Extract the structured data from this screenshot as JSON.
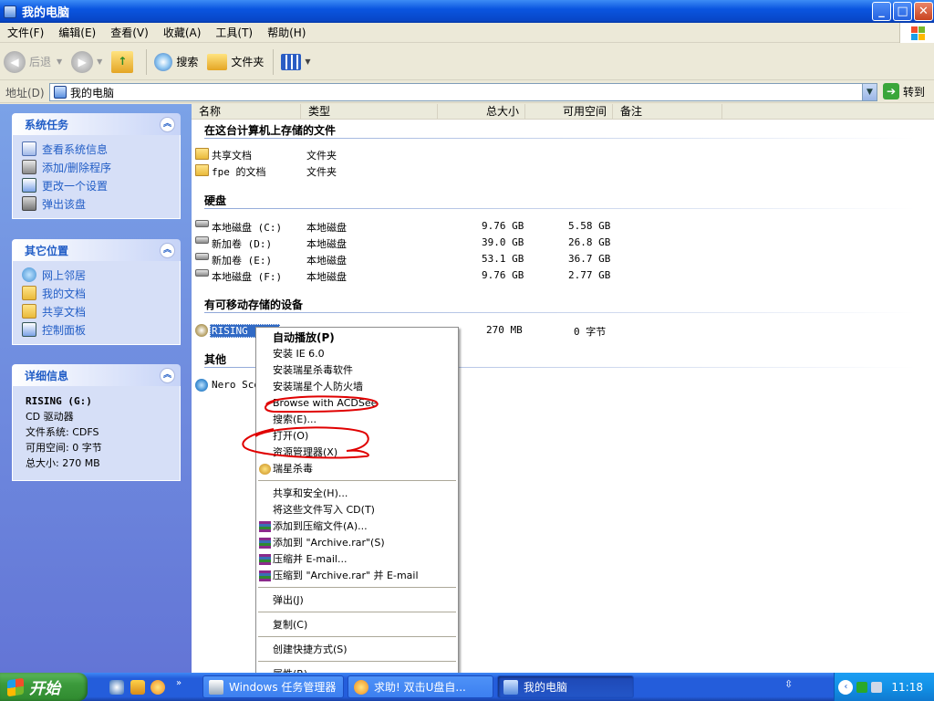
{
  "window": {
    "title": "我的电脑",
    "buttons": {
      "minimize": "_",
      "maximize": "□",
      "close": "✕"
    }
  },
  "menubar": [
    "文件(F)",
    "编辑(E)",
    "查看(V)",
    "收藏(A)",
    "工具(T)",
    "帮助(H)"
  ],
  "toolbar": {
    "back": "后退",
    "search": "搜索",
    "folders": "文件夹"
  },
  "address": {
    "label": "地址(D)",
    "value": "我的电脑",
    "go": "转到"
  },
  "sidebar": {
    "system_tasks": {
      "title": "系统任务",
      "items": [
        "查看系统信息",
        "添加/删除程序",
        "更改一个设置",
        "弹出该盘"
      ]
    },
    "other_places": {
      "title": "其它位置",
      "items": [
        "网上邻居",
        "我的文档",
        "共享文档",
        "控制面板"
      ]
    },
    "details": {
      "title": "详细信息",
      "name": "RISING (G:)",
      "type": "CD 驱动器",
      "filesystem": "文件系统: CDFS",
      "free": "可用空间: 0 字节",
      "total": "总大小: 270 MB"
    }
  },
  "columns": [
    "名称",
    "类型",
    "总大小",
    "可用空间",
    "备注"
  ],
  "groups": {
    "stored": "在这台计算机上存储的文件",
    "harddisk": "硬盘",
    "removable": "有可移动存储的设备",
    "other": "其他"
  },
  "stored_files": [
    {
      "name": "共享文档",
      "type": "文件夹"
    },
    {
      "name": "fpe 的文档",
      "type": "文件夹"
    }
  ],
  "drives": [
    {
      "name": "本地磁盘 (C:)",
      "type": "本地磁盘",
      "total": "9.76 GB",
      "free": "5.58 GB"
    },
    {
      "name": "新加卷 (D:)",
      "type": "本地磁盘",
      "total": "39.0 GB",
      "free": "26.8 GB"
    },
    {
      "name": "新加卷 (E:)",
      "type": "本地磁盘",
      "total": "53.1 GB",
      "free": "36.7 GB"
    },
    {
      "name": "本地磁盘 (F:)",
      "type": "本地磁盘",
      "total": "9.76 GB",
      "free": "2.77 GB"
    }
  ],
  "removable": {
    "name": "RISING (G:)",
    "type": "CD 驱动器",
    "total": "270 MB",
    "free": "0 字节"
  },
  "other_item": {
    "name": "Nero Sco"
  },
  "context_menu": [
    "自动播放(P)",
    "安装 IE 6.0",
    "安装瑞星杀毒软件",
    "安装瑞星个人防火墙",
    "Browse with ACDSee",
    "搜索(E)...",
    "打开(O)",
    "资源管理器(X)",
    "瑞星杀毒",
    "共享和安全(H)...",
    "将这些文件写入 CD(T)",
    "添加到压缩文件(A)...",
    "添加到 \"Archive.rar\"(S)",
    "压缩并 E-mail...",
    "压缩到 \"Archive.rar\" 并 E-mail",
    "弹出(J)",
    "复制(C)",
    "创建快捷方式(S)",
    "属性(R)"
  ],
  "taskbar": {
    "start": "开始",
    "tasks": [
      "Windows 任务管理器",
      "求助! 双击U盘自...",
      "我的电脑"
    ],
    "clock": "11:18"
  },
  "colors": {
    "title_blue": "#0a55e0",
    "sidebar_link": "#215dc6",
    "selection": "#316ac5",
    "annotation_red": "#e00000"
  }
}
